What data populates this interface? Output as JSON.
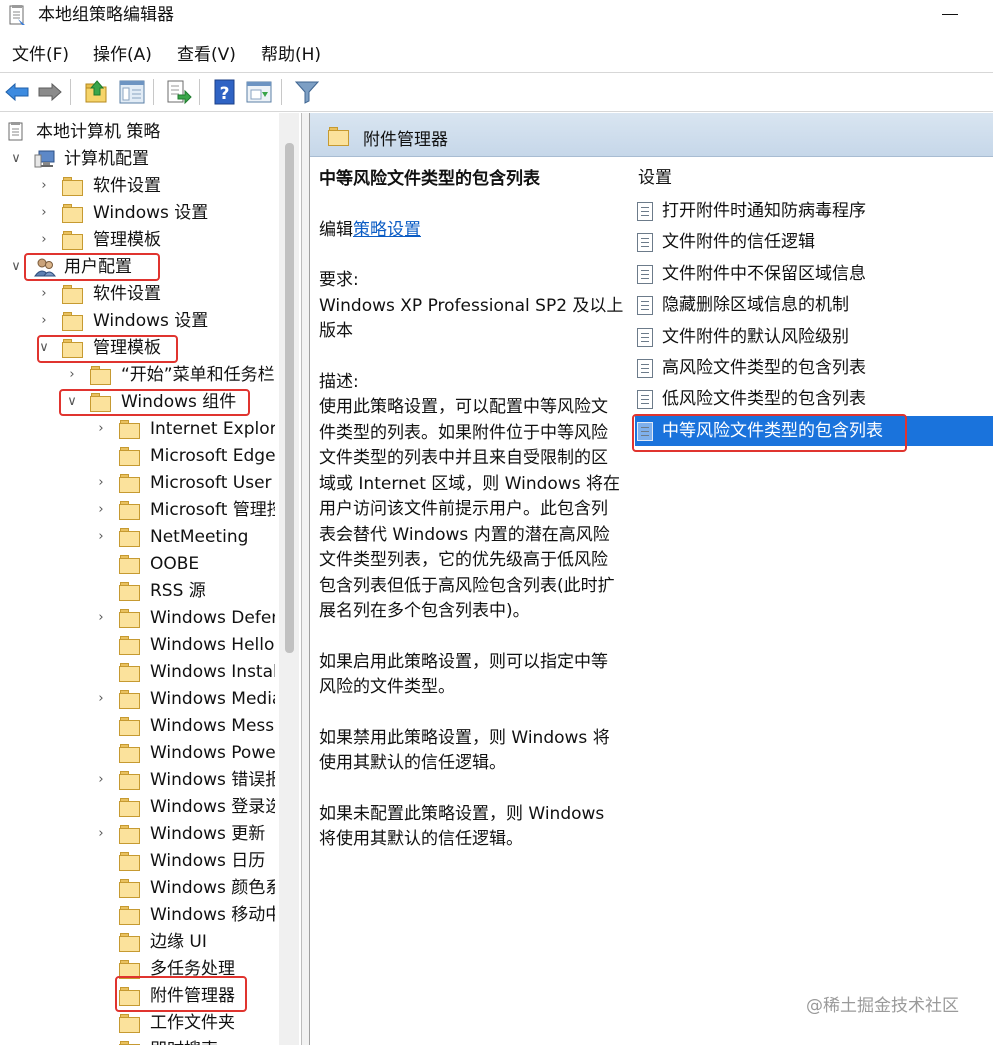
{
  "window": {
    "title": "本地组策略编辑器"
  },
  "menu": [
    "文件(F)",
    "操作(A)",
    "查看(V)",
    "帮助(H)"
  ],
  "toolbar": {
    "buttons": [
      "back-icon",
      "forward-icon",
      "up-folder-icon",
      "show-hide-tree-icon",
      "export-list-icon",
      "help-icon",
      "properties-icon",
      "filter-icon"
    ]
  },
  "tree": {
    "items": [
      {
        "label": "本地计算机 策略"
      },
      {
        "label": "计算机配置"
      },
      {
        "label": "软件设置"
      },
      {
        "label": "Windows 设置"
      },
      {
        "label": "管理模板"
      },
      {
        "label": "用户配置"
      },
      {
        "label": "软件设置"
      },
      {
        "label": "Windows 设置"
      },
      {
        "label": "管理模板"
      },
      {
        "label": "“开始”菜单和任务栏"
      },
      {
        "label": "Windows 组件"
      },
      {
        "label": "Internet Explorer"
      },
      {
        "label": "Microsoft Edge"
      },
      {
        "label": "Microsoft User Experience Virtualization"
      },
      {
        "label": "Microsoft 管理控制台"
      },
      {
        "label": "NetMeeting"
      },
      {
        "label": "OOBE"
      },
      {
        "label": "RSS 源"
      },
      {
        "label": "Windows Defender SmartScreen"
      },
      {
        "label": "Windows Hello 企业版"
      },
      {
        "label": "Windows Installer"
      },
      {
        "label": "Windows Media Player"
      },
      {
        "label": "Windows Messenger"
      },
      {
        "label": "Windows PowerShell"
      },
      {
        "label": "Windows 错误报告"
      },
      {
        "label": "Windows 登录选项"
      },
      {
        "label": "Windows 更新"
      },
      {
        "label": "Windows 日历"
      },
      {
        "label": "Windows 颜色系统"
      },
      {
        "label": "Windows 移动中心"
      },
      {
        "label": "边缘 UI"
      },
      {
        "label": "多任务处理"
      },
      {
        "label": "附件管理器"
      },
      {
        "label": "工作文件夹"
      },
      {
        "label": "即时搜索"
      }
    ]
  },
  "content": {
    "header_title": "附件管理器",
    "description": {
      "title": "中等风险文件类型的包含列表",
      "edit_prefix": "编辑",
      "edit_link": "策略设置",
      "requirements_label": "要求:",
      "requirements": "Windows XP Professional SP2 及以上版本",
      "description_label": "描述:",
      "description_text": "使用此策略设置，可以配置中等风险文件类型的列表。如果附件位于中等风险文件类型的列表中并且来自受限制的区域或 Internet 区域，则 Windows 将在用户访问该文件前提示用户。此包含列表会替代 Windows 内置的潜在高风险文件类型列表，它的优先级高于低风险包含列表但低于高风险包含列表(此时扩展名列在多个包含列表中)。",
      "enabled_text": "如果启用此策略设置，则可以指定中等风险的文件类型。",
      "disabled_text": "如果禁用此策略设置，则 Windows 将使用其默认的信任逻辑。",
      "not_configured_text": "如果未配置此策略设置，则 Windows 将使用其默认的信任逻辑。"
    },
    "settings_header": "设置",
    "settings": [
      "打开附件时通知防病毒程序",
      "文件附件的信任逻辑",
      "文件附件中不保留区域信息",
      "隐藏删除区域信息的机制",
      "文件附件的默认风险级别",
      "高风险文件类型的包含列表",
      "低风险文件类型的包含列表",
      "中等风险文件类型的包含列表"
    ],
    "selected_setting": "中等风险文件类型的包含列表"
  },
  "colors": {
    "selection": "#1a73dc",
    "annotation": "#e0342f",
    "header_gradient_top": "#d9e5f1",
    "link": "#0b5cc4"
  },
  "watermark": "@稀土掘金技术社区"
}
